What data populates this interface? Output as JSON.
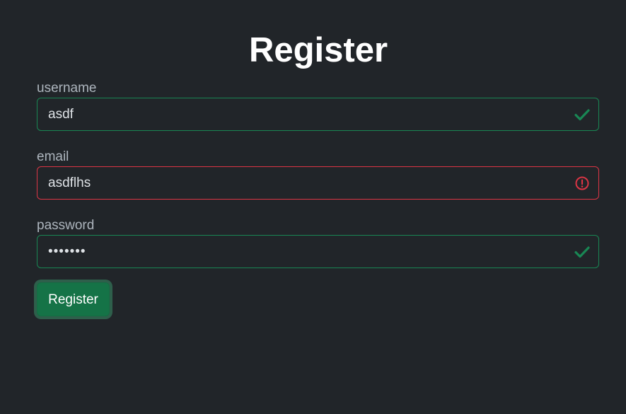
{
  "form": {
    "title": "Register",
    "fields": [
      {
        "label": "username",
        "value": "asdf",
        "state": "valid",
        "icon": "check-icon"
      },
      {
        "label": "email",
        "value": "asdflhs",
        "state": "invalid",
        "icon": "error-circle-icon"
      },
      {
        "label": "password",
        "value": "•••••••",
        "state": "valid",
        "icon": "check-icon"
      }
    ],
    "submit_label": "Register"
  },
  "colors": {
    "background": "#212529",
    "valid": "#198754",
    "invalid": "#dc3545",
    "button": "#157347"
  }
}
